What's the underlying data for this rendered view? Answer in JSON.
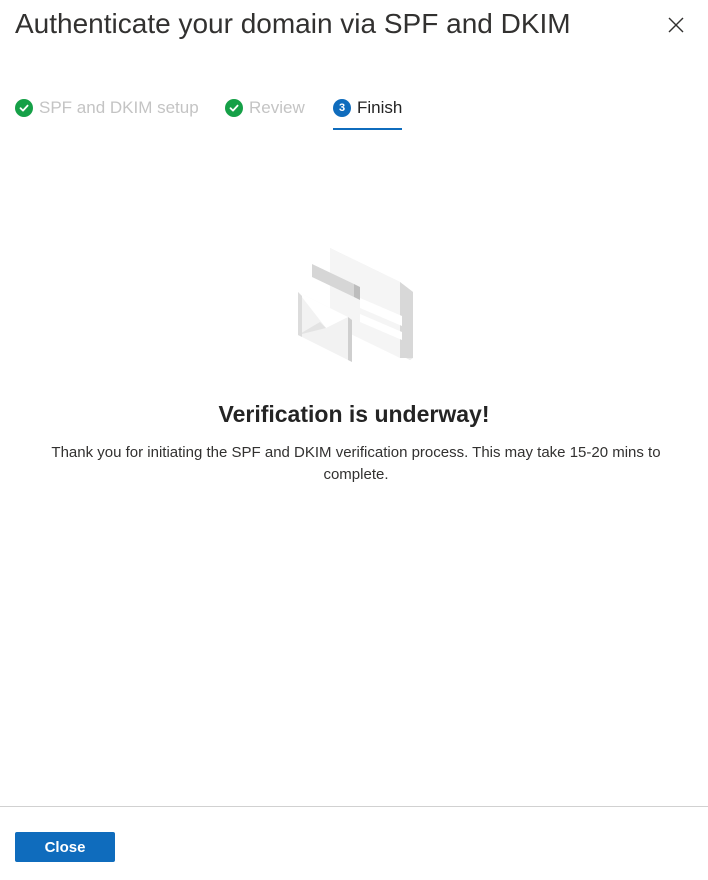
{
  "panel": {
    "title": "Authenticate your domain via SPF and DKIM",
    "close_icon": "close-x-icon"
  },
  "steps": [
    {
      "label": "SPF and DKIM setup",
      "state": "completed",
      "icon": "checkmark-circle-icon"
    },
    {
      "label": "Review",
      "state": "completed",
      "icon": "checkmark-circle-icon"
    },
    {
      "label": "Finish",
      "state": "current",
      "number": "3"
    }
  ],
  "result": {
    "illustration_icon": "email-verification-illustration",
    "headline": "Verification is underway!",
    "message": "Thank you for initiating the SPF and DKIM verification process. This may take 15-20 mins to complete."
  },
  "footer": {
    "close_label": "Close"
  },
  "colors": {
    "accent": "#0f6cbd",
    "success": "#15a047",
    "muted_text": "#c4c4c4"
  }
}
